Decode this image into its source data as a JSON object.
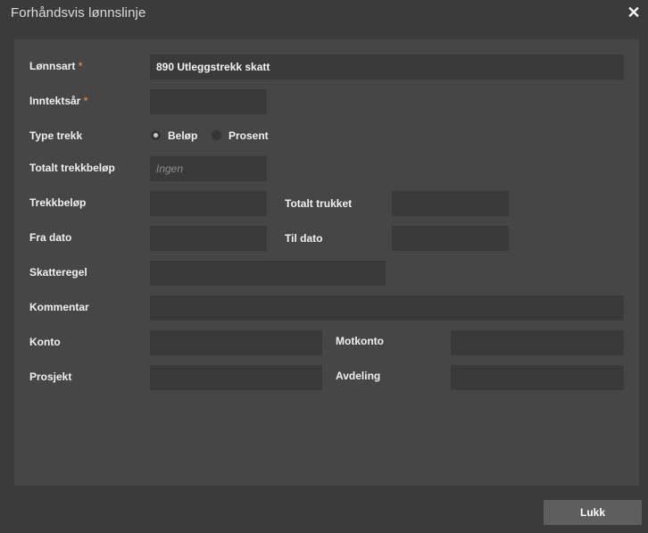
{
  "dialog": {
    "title": "Forhåndsvis lønnslinje",
    "close_glyph": "✕"
  },
  "form": {
    "required_marker": "*",
    "lonnsart": {
      "label": "Lønnsart",
      "value": "890 Utleggstrekk skatt"
    },
    "inntektsar": {
      "label": "Inntektsår",
      "value": ""
    },
    "type_trekk": {
      "label": "Type trekk",
      "options": [
        "Beløp",
        "Prosent"
      ],
      "selected": "Beløp"
    },
    "totalt_trekkbelop": {
      "label": "Totalt trekkbeløp",
      "placeholder": "Ingen"
    },
    "trekkbelop": {
      "label": "Trekkbeløp",
      "value": ""
    },
    "totalt_trukket": {
      "label": "Totalt trukket",
      "value": ""
    },
    "fra_dato": {
      "label": "Fra dato",
      "value": ""
    },
    "til_dato": {
      "label": "Til dato",
      "value": ""
    },
    "skatteregel": {
      "label": "Skatteregel",
      "value": ""
    },
    "kommentar": {
      "label": "Kommentar",
      "value": ""
    },
    "konto": {
      "label": "Konto",
      "value": ""
    },
    "motkonto": {
      "label": "Motkonto",
      "value": ""
    },
    "prosjekt": {
      "label": "Prosjekt",
      "value": ""
    },
    "avdeling": {
      "label": "Avdeling",
      "value": ""
    }
  },
  "footer": {
    "close_button_label": "Lukk"
  },
  "colors": {
    "background": "#3b3b3b",
    "panel": "#464646",
    "field": "#3a3a3a",
    "required": "#e07b2a",
    "button": "#5e5e5e"
  }
}
